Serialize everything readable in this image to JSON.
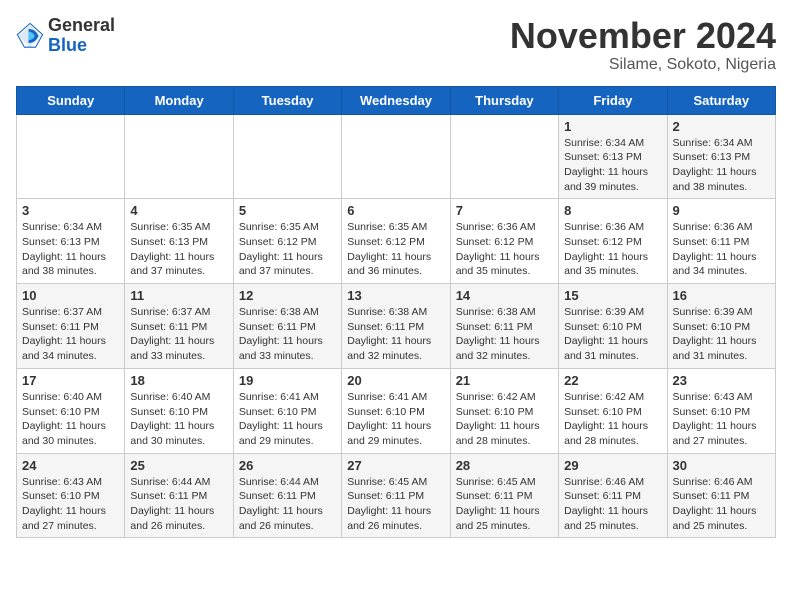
{
  "header": {
    "logo": {
      "general": "General",
      "blue": "Blue"
    },
    "month": "November 2024",
    "location": "Silame, Sokoto, Nigeria"
  },
  "weekdays": [
    "Sunday",
    "Monday",
    "Tuesday",
    "Wednesday",
    "Thursday",
    "Friday",
    "Saturday"
  ],
  "weeks": [
    [
      {
        "day": "",
        "sunrise": "",
        "sunset": "",
        "daylight": ""
      },
      {
        "day": "",
        "sunrise": "",
        "sunset": "",
        "daylight": ""
      },
      {
        "day": "",
        "sunrise": "",
        "sunset": "",
        "daylight": ""
      },
      {
        "day": "",
        "sunrise": "",
        "sunset": "",
        "daylight": ""
      },
      {
        "day": "",
        "sunrise": "",
        "sunset": "",
        "daylight": ""
      },
      {
        "day": "1",
        "sunrise": "Sunrise: 6:34 AM",
        "sunset": "Sunset: 6:13 PM",
        "daylight": "Daylight: 11 hours and 39 minutes."
      },
      {
        "day": "2",
        "sunrise": "Sunrise: 6:34 AM",
        "sunset": "Sunset: 6:13 PM",
        "daylight": "Daylight: 11 hours and 38 minutes."
      }
    ],
    [
      {
        "day": "3",
        "sunrise": "Sunrise: 6:34 AM",
        "sunset": "Sunset: 6:13 PM",
        "daylight": "Daylight: 11 hours and 38 minutes."
      },
      {
        "day": "4",
        "sunrise": "Sunrise: 6:35 AM",
        "sunset": "Sunset: 6:13 PM",
        "daylight": "Daylight: 11 hours and 37 minutes."
      },
      {
        "day": "5",
        "sunrise": "Sunrise: 6:35 AM",
        "sunset": "Sunset: 6:12 PM",
        "daylight": "Daylight: 11 hours and 37 minutes."
      },
      {
        "day": "6",
        "sunrise": "Sunrise: 6:35 AM",
        "sunset": "Sunset: 6:12 PM",
        "daylight": "Daylight: 11 hours and 36 minutes."
      },
      {
        "day": "7",
        "sunrise": "Sunrise: 6:36 AM",
        "sunset": "Sunset: 6:12 PM",
        "daylight": "Daylight: 11 hours and 35 minutes."
      },
      {
        "day": "8",
        "sunrise": "Sunrise: 6:36 AM",
        "sunset": "Sunset: 6:12 PM",
        "daylight": "Daylight: 11 hours and 35 minutes."
      },
      {
        "day": "9",
        "sunrise": "Sunrise: 6:36 AM",
        "sunset": "Sunset: 6:11 PM",
        "daylight": "Daylight: 11 hours and 34 minutes."
      }
    ],
    [
      {
        "day": "10",
        "sunrise": "Sunrise: 6:37 AM",
        "sunset": "Sunset: 6:11 PM",
        "daylight": "Daylight: 11 hours and 34 minutes."
      },
      {
        "day": "11",
        "sunrise": "Sunrise: 6:37 AM",
        "sunset": "Sunset: 6:11 PM",
        "daylight": "Daylight: 11 hours and 33 minutes."
      },
      {
        "day": "12",
        "sunrise": "Sunrise: 6:38 AM",
        "sunset": "Sunset: 6:11 PM",
        "daylight": "Daylight: 11 hours and 33 minutes."
      },
      {
        "day": "13",
        "sunrise": "Sunrise: 6:38 AM",
        "sunset": "Sunset: 6:11 PM",
        "daylight": "Daylight: 11 hours and 32 minutes."
      },
      {
        "day": "14",
        "sunrise": "Sunrise: 6:38 AM",
        "sunset": "Sunset: 6:11 PM",
        "daylight": "Daylight: 11 hours and 32 minutes."
      },
      {
        "day": "15",
        "sunrise": "Sunrise: 6:39 AM",
        "sunset": "Sunset: 6:10 PM",
        "daylight": "Daylight: 11 hours and 31 minutes."
      },
      {
        "day": "16",
        "sunrise": "Sunrise: 6:39 AM",
        "sunset": "Sunset: 6:10 PM",
        "daylight": "Daylight: 11 hours and 31 minutes."
      }
    ],
    [
      {
        "day": "17",
        "sunrise": "Sunrise: 6:40 AM",
        "sunset": "Sunset: 6:10 PM",
        "daylight": "Daylight: 11 hours and 30 minutes."
      },
      {
        "day": "18",
        "sunrise": "Sunrise: 6:40 AM",
        "sunset": "Sunset: 6:10 PM",
        "daylight": "Daylight: 11 hours and 30 minutes."
      },
      {
        "day": "19",
        "sunrise": "Sunrise: 6:41 AM",
        "sunset": "Sunset: 6:10 PM",
        "daylight": "Daylight: 11 hours and 29 minutes."
      },
      {
        "day": "20",
        "sunrise": "Sunrise: 6:41 AM",
        "sunset": "Sunset: 6:10 PM",
        "daylight": "Daylight: 11 hours and 29 minutes."
      },
      {
        "day": "21",
        "sunrise": "Sunrise: 6:42 AM",
        "sunset": "Sunset: 6:10 PM",
        "daylight": "Daylight: 11 hours and 28 minutes."
      },
      {
        "day": "22",
        "sunrise": "Sunrise: 6:42 AM",
        "sunset": "Sunset: 6:10 PM",
        "daylight": "Daylight: 11 hours and 28 minutes."
      },
      {
        "day": "23",
        "sunrise": "Sunrise: 6:43 AM",
        "sunset": "Sunset: 6:10 PM",
        "daylight": "Daylight: 11 hours and 27 minutes."
      }
    ],
    [
      {
        "day": "24",
        "sunrise": "Sunrise: 6:43 AM",
        "sunset": "Sunset: 6:10 PM",
        "daylight": "Daylight: 11 hours and 27 minutes."
      },
      {
        "day": "25",
        "sunrise": "Sunrise: 6:44 AM",
        "sunset": "Sunset: 6:11 PM",
        "daylight": "Daylight: 11 hours and 26 minutes."
      },
      {
        "day": "26",
        "sunrise": "Sunrise: 6:44 AM",
        "sunset": "Sunset: 6:11 PM",
        "daylight": "Daylight: 11 hours and 26 minutes."
      },
      {
        "day": "27",
        "sunrise": "Sunrise: 6:45 AM",
        "sunset": "Sunset: 6:11 PM",
        "daylight": "Daylight: 11 hours and 26 minutes."
      },
      {
        "day": "28",
        "sunrise": "Sunrise: 6:45 AM",
        "sunset": "Sunset: 6:11 PM",
        "daylight": "Daylight: 11 hours and 25 minutes."
      },
      {
        "day": "29",
        "sunrise": "Sunrise: 6:46 AM",
        "sunset": "Sunset: 6:11 PM",
        "daylight": "Daylight: 11 hours and 25 minutes."
      },
      {
        "day": "30",
        "sunrise": "Sunrise: 6:46 AM",
        "sunset": "Sunset: 6:11 PM",
        "daylight": "Daylight: 11 hours and 25 minutes."
      }
    ]
  ]
}
